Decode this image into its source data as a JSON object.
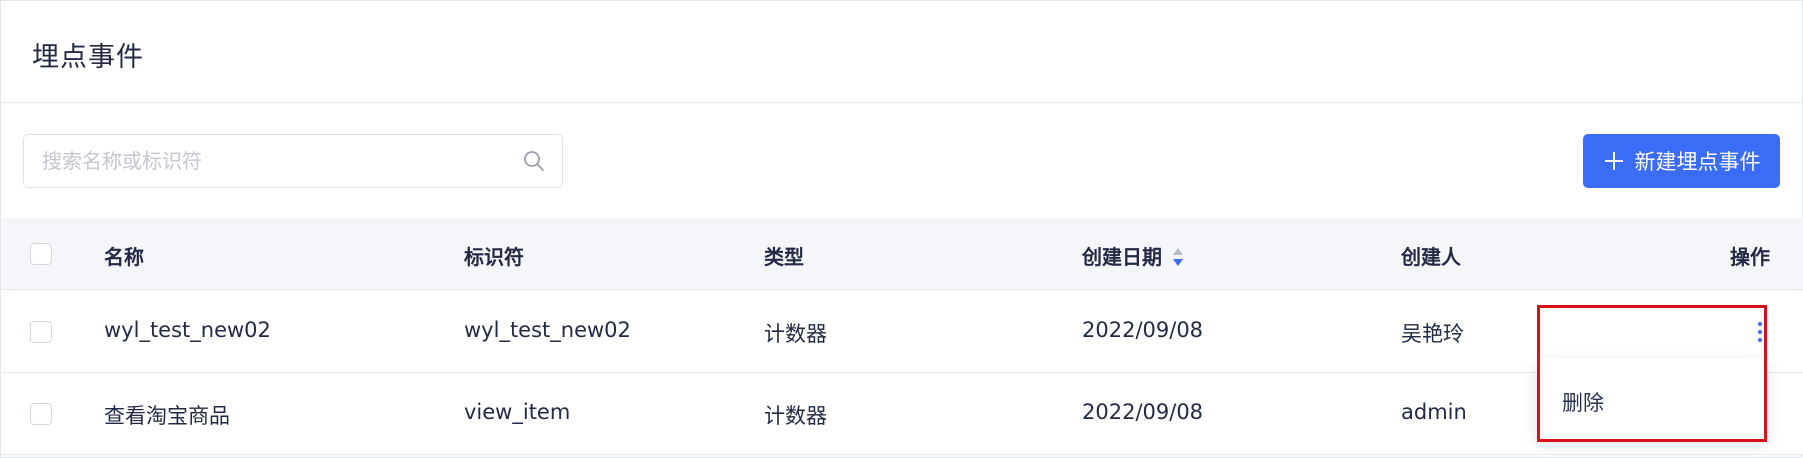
{
  "page": {
    "title": "埋点事件"
  },
  "search": {
    "placeholder": "搜索名称或标识符",
    "value": ""
  },
  "toolbar": {
    "new_button_label": "新建埋点事件"
  },
  "table": {
    "columns": {
      "name": "名称",
      "identifier": "标识符",
      "type": "类型",
      "created_date": "创建日期",
      "creator": "创建人",
      "actions": "操作"
    },
    "sort": {
      "column": "created_date",
      "direction": "descending"
    },
    "rows": [
      {
        "name": "wyl_test_new02",
        "identifier": "wyl_test_new02",
        "type": "计数器",
        "created_date": "2022/09/08",
        "creator": "吴艳玲"
      },
      {
        "name": "查看淘宝商品",
        "identifier": "view_item",
        "type": "计数器",
        "created_date": "2022/09/08",
        "creator": "admin"
      }
    ]
  },
  "action_menu": {
    "items": [
      "删除"
    ]
  },
  "colors": {
    "accent": "#3b6cf6",
    "highlight": "#d8101b",
    "header_bg": "#f5f6f9"
  },
  "icons": {
    "search": "search-icon",
    "plus": "plus-icon",
    "sort": "sort-icon",
    "more": "more-vertical-icon"
  }
}
